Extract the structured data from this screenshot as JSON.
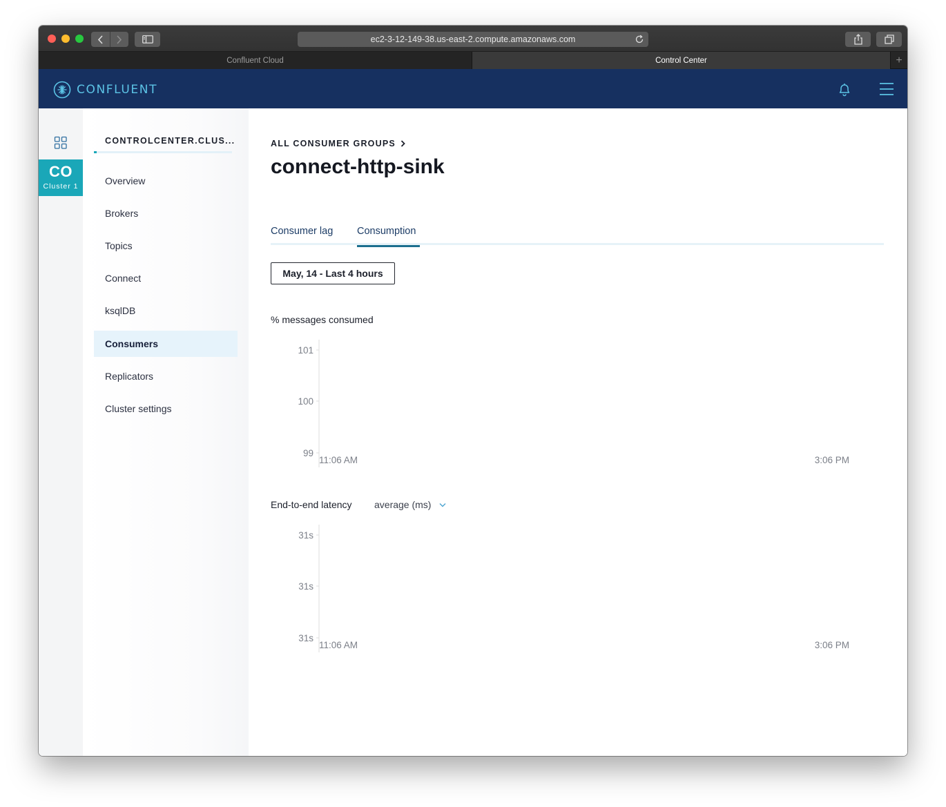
{
  "browser": {
    "url": "ec2-3-12-149-38.us-east-2.compute.amazonaws.com",
    "tabs": [
      {
        "label": "Confluent Cloud",
        "active": false
      },
      {
        "label": "Control Center",
        "active": true
      }
    ]
  },
  "header": {
    "brand": "CONFLUENT",
    "icons": [
      "confluent-logo-icon",
      "bell-icon",
      "hamburger-menu-icon"
    ]
  },
  "rail": {
    "cluster_abbr": "CO",
    "cluster_name": "Cluster 1",
    "icons": [
      "grid-icon"
    ]
  },
  "sidebar": {
    "cluster_title": "CONTROLCENTER.CLUS...",
    "items": [
      {
        "label": "Overview",
        "active": false
      },
      {
        "label": "Brokers",
        "active": false
      },
      {
        "label": "Topics",
        "active": false
      },
      {
        "label": "Connect",
        "active": false
      },
      {
        "label": "ksqlDB",
        "active": false
      },
      {
        "label": "Consumers",
        "active": true
      },
      {
        "label": "Replicators",
        "active": false
      },
      {
        "label": "Cluster settings",
        "active": false
      }
    ]
  },
  "main": {
    "breadcrumb": "ALL CONSUMER GROUPS",
    "title": "connect-http-sink",
    "tabs": [
      {
        "label": "Consumer lag",
        "active": false
      },
      {
        "label": "Consumption",
        "active": true
      }
    ],
    "date_range": "May, 14 - Last 4 hours",
    "chart1_label": "% messages consumed",
    "chart2_label": "End-to-end latency",
    "latency_select": "average (ms)"
  },
  "chart_data": [
    {
      "type": "line",
      "title": "% messages consumed",
      "xlabel": "",
      "ylabel": "",
      "x_tick_labels": [
        "11:06 AM",
        "3:06 PM"
      ],
      "y_tick_labels": [
        "101",
        "100",
        "99"
      ],
      "ylim": [
        99,
        101
      ],
      "series": []
    },
    {
      "type": "line",
      "title": "End-to-end latency",
      "xlabel": "",
      "ylabel": "",
      "x_tick_labels": [
        "11:06 AM",
        "3:06 PM"
      ],
      "y_tick_labels": [
        "31s",
        "31s",
        "31s"
      ],
      "series": []
    }
  ],
  "colors": {
    "header_bg": "#163060",
    "brand_accent": "#5cc4e6",
    "cluster_tile": "#1aa7b8",
    "active_nav_bg": "#e6f3fb",
    "tab_underline": "#1c6f8f"
  }
}
